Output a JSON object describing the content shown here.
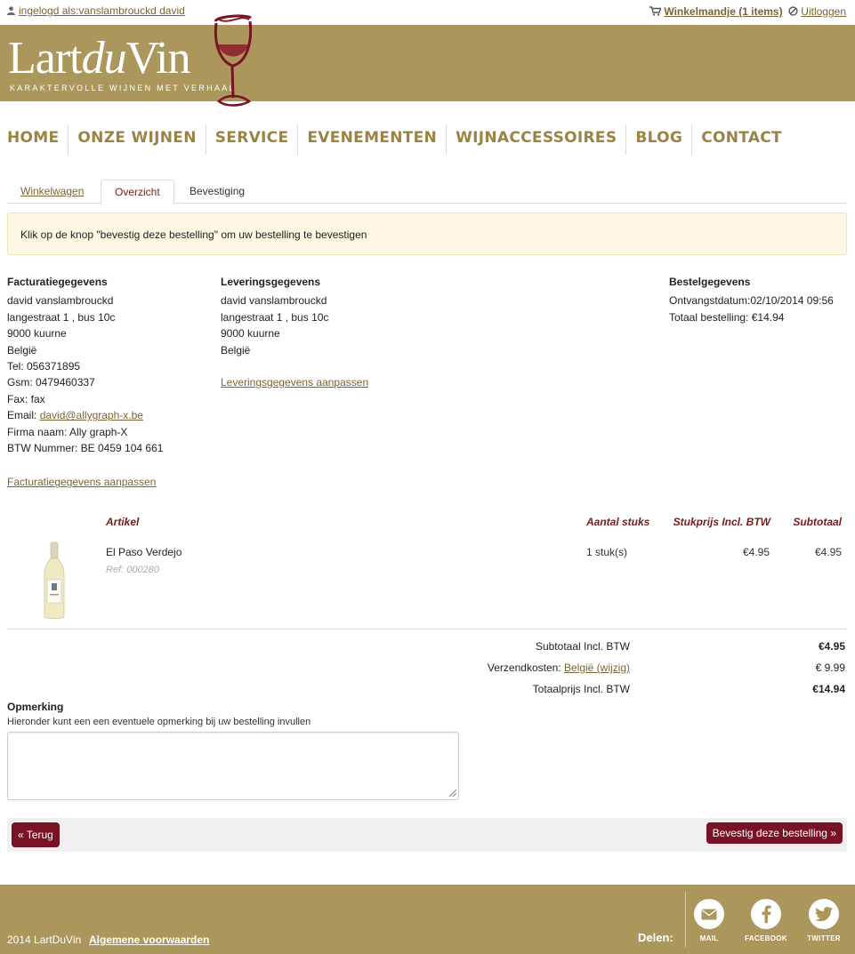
{
  "topbar": {
    "login_text": "ingelogd als:vanslambrouckd david",
    "cart_text": "Winkelmandje (1 items)",
    "logout_text": "Uitloggen"
  },
  "header": {
    "logo_part1": "Lart",
    "logo_part2": "du",
    "logo_part3": "Vin",
    "tagline": "KARAKTERVOLLE WIJNEN MET VERHAAL"
  },
  "nav": {
    "items": [
      "HOME",
      "ONZE WIJNEN",
      "SERVICE",
      "EVENEMENTEN",
      "WIJNACCESSOIRES",
      "BLOG",
      "CONTACT"
    ]
  },
  "tabs": {
    "cart": "Winkelwagen",
    "overview": "Overzicht",
    "confirm": "Bevestiging"
  },
  "notice": "Klik op de knop \"bevestig deze bestelling\" om uw bestelling te bevestigen",
  "billing": {
    "title": "Facturatiegegevens",
    "name": "david vanslambrouckd",
    "street": "langestraat 1 , bus 10c",
    "city": "9000 kuurne",
    "country": "België",
    "tel": "Tel: 056371895",
    "gsm": "Gsm: 0479460337",
    "fax": "Fax: fax",
    "email_label": "Email: ",
    "email": "david@allygraph-x.be",
    "company": "Firma naam: Ally graph-X",
    "vat": "BTW Nummer: BE 0459 104 661",
    "edit_link": "Facturatiegegevens aanpassen"
  },
  "delivery": {
    "title": "Leveringsgegevens",
    "name": "david vanslambrouckd",
    "street": "langestraat 1 , bus 10c",
    "city": "9000 kuurne",
    "country": "België",
    "edit_link": "Leveringsgegevens aanpassen"
  },
  "order": {
    "title": "Bestelgegevens",
    "received": "Ontvangstdatum:02/10/2014 09:56",
    "total": "Totaal bestelling: €14.94"
  },
  "table": {
    "headers": {
      "article": "Artikel",
      "qty": "Aantal stuks",
      "unit_price": "Stukprijs Incl. BTW",
      "subtotal": "Subtotaal"
    },
    "rows": [
      {
        "name": "El Paso Verdejo",
        "ref": "Ref: 000280",
        "qty": "1 stuk(s)",
        "unit_price": "€4.95",
        "subtotal": "€4.95"
      }
    ]
  },
  "summary": {
    "subtotal_label": "Subtotaal Incl. BTW",
    "subtotal_value": "€4.95",
    "shipping_label": "Verzendkosten: ",
    "shipping_link": "België (wijzig)",
    "shipping_value": "€ 9.99",
    "total_label": "Totaalprijs Incl. BTW",
    "total_value": "€14.94"
  },
  "remark": {
    "title": "Opmerking",
    "help": "Hieronder kunt een een eventuele opmerking bij uw bestelling invullen",
    "value": ""
  },
  "actions": {
    "back": "« Terug",
    "confirm": "Bevestig deze bestelling »"
  },
  "footer": {
    "copyright": "2014 LartDuVin",
    "terms": "Algemene voorwaarden",
    "share_label": "Delen:",
    "social": [
      "MAIL",
      "FACEBOOK",
      "TWITTER"
    ]
  },
  "colors": {
    "brand_gold": "#ab975c",
    "wine_red": "#7a1226",
    "link": "#7a6433"
  }
}
